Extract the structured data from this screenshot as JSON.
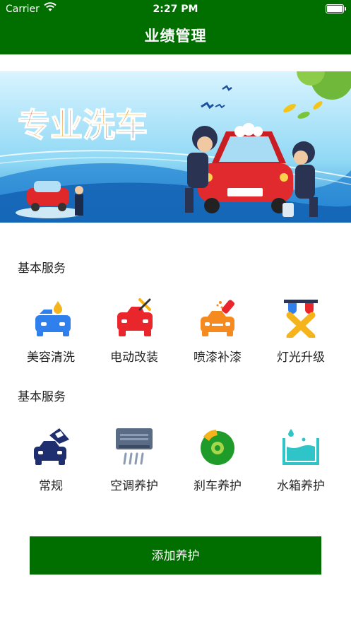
{
  "status_bar": {
    "carrier": "Carrier",
    "time": "2:27 PM"
  },
  "nav": {
    "title": "业绩管理"
  },
  "banner": {
    "headline": "专业洗车"
  },
  "sections": [
    {
      "title": "基本服务",
      "items": [
        {
          "label": "美容清洗",
          "icon": "car-wash-icon"
        },
        {
          "label": "电动改装",
          "icon": "car-repair-tools-icon"
        },
        {
          "label": "喷漆补漆",
          "icon": "spray-paint-icon"
        },
        {
          "label": "灯光升级",
          "icon": "light-upgrade-icon"
        }
      ]
    },
    {
      "title": "基本服务",
      "items": [
        {
          "label": "常规",
          "icon": "car-hood-icon"
        },
        {
          "label": "空调养护",
          "icon": "air-conditioner-icon"
        },
        {
          "label": "刹车养护",
          "icon": "brake-disc-icon"
        },
        {
          "label": "水箱养护",
          "icon": "water-tank-icon"
        }
      ]
    }
  ],
  "action": {
    "add_label": "添加养护"
  },
  "colors": {
    "primary": "#006f00",
    "blue": "#2f80ed",
    "red": "#e8262b",
    "orange": "#f58a1f",
    "navy": "#1f2e6e",
    "teal": "#2ec4c8"
  }
}
